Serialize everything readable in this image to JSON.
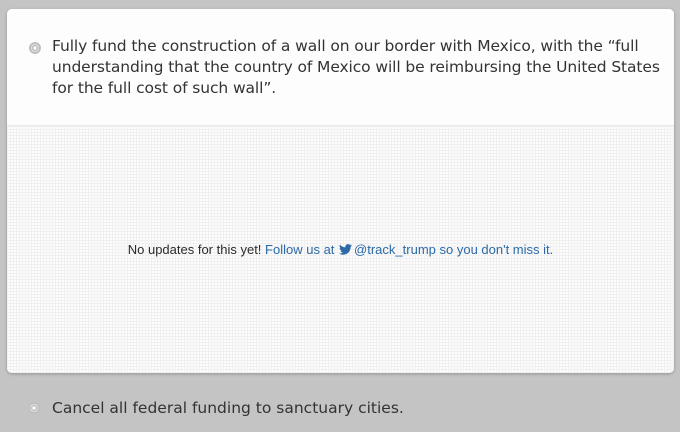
{
  "promise": {
    "text": "Fully fund the construction of a wall on our border with Mexico, with the “full understanding that the country of Mexico will be reimbursing the United States for the full cost of such wall”."
  },
  "updates": {
    "empty_text": "No updates for this yet!",
    "follow_prefix": "Follow us at",
    "handle": "@track_trump",
    "follow_suffix": "so you don't miss it.",
    "twitter_icon": "twitter-bird-icon",
    "link_color": "#2b6aa6"
  },
  "next_promise": {
    "text": "Cancel all federal funding to sanctuary cities."
  },
  "colors": {
    "page_background": "#c4c4c4",
    "card_background": "#ffffff",
    "text": "#333333"
  }
}
